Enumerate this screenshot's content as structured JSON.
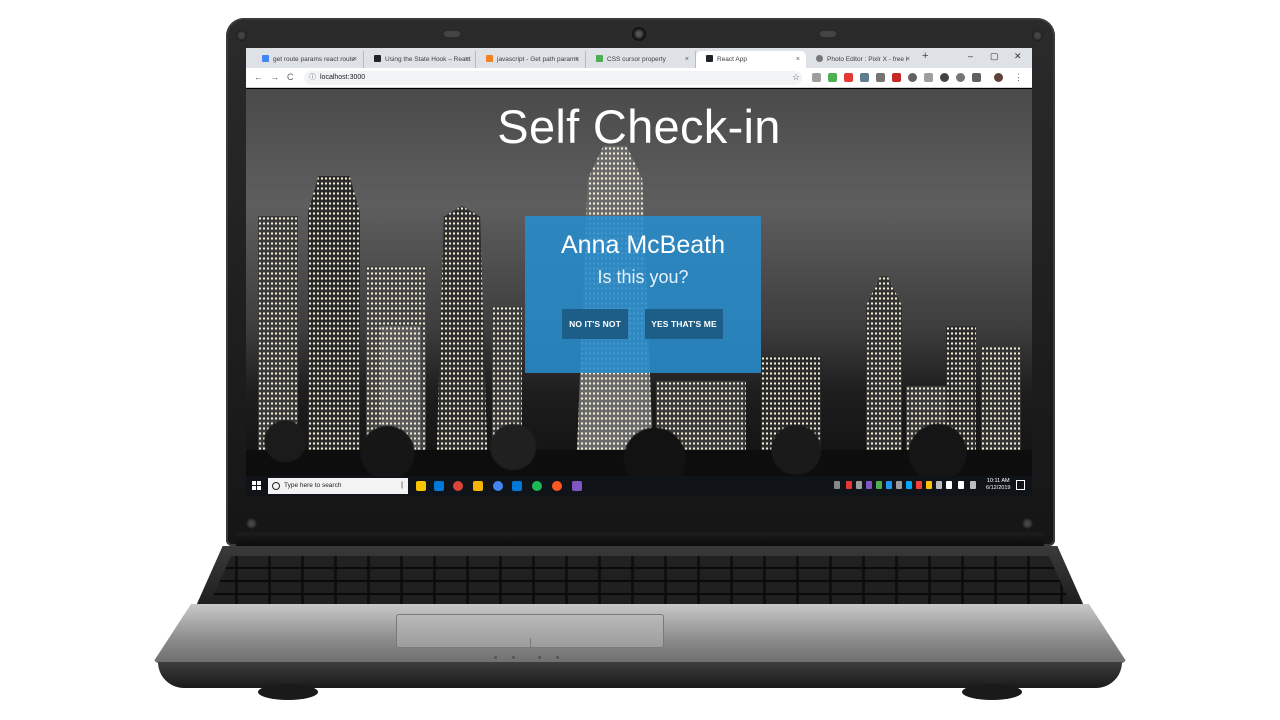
{
  "browser": {
    "tabs": [
      {
        "label": "get route params react route",
        "favicon_color": "#4285f4"
      },
      {
        "label": "Using the State Hook – React",
        "favicon_color": "#20232a"
      },
      {
        "label": "javascript - Get path params",
        "favicon_color": "#f48024"
      },
      {
        "label": "CSS cursor property",
        "favicon_color": "#4caf50"
      },
      {
        "label": "React App",
        "favicon_color": "#20232a",
        "active": true
      },
      {
        "label": "Photo Editor : Pixlr X - free i",
        "favicon_color": "#777777"
      }
    ],
    "tab_close_glyph": "×",
    "new_tab_glyph": "+",
    "window_controls": {
      "minimize": "–",
      "maximize": "▢",
      "close": "✕"
    },
    "nav": {
      "back": "←",
      "forward": "→",
      "reload": "C"
    },
    "address": "localhost:3000",
    "address_info_icon": "ⓘ",
    "star_icon": "☆",
    "menu_icon": "⋮",
    "extension_colors": [
      "#9e9e9e",
      "#4caf50",
      "#607d8b",
      "#e53935",
      "#757575",
      "#616161",
      "#c62828",
      "#424242",
      "#9e9e9e",
      "#757575",
      "#424242",
      "#616161",
      "#757575",
      "#5d4037"
    ]
  },
  "page": {
    "title": "Self Check-in",
    "card": {
      "name": "Anna McBeath",
      "question": "Is this you?",
      "no_button": "NO IT'S NOT",
      "yes_button": "YES THAT'S ME"
    },
    "accent_color": "#288ccd"
  },
  "taskbar": {
    "search_placeholder": "Type here to search",
    "mic_icon": "🎤",
    "app_icon_colors": [
      "#f9c400",
      "#0078d7",
      "#db4437",
      "#f4b400",
      "#4285f4",
      "#0078d7",
      "#1db954",
      "#ff5722",
      "#7e57c2"
    ],
    "time": "10:11 AM",
    "date": "6/12/2019"
  }
}
